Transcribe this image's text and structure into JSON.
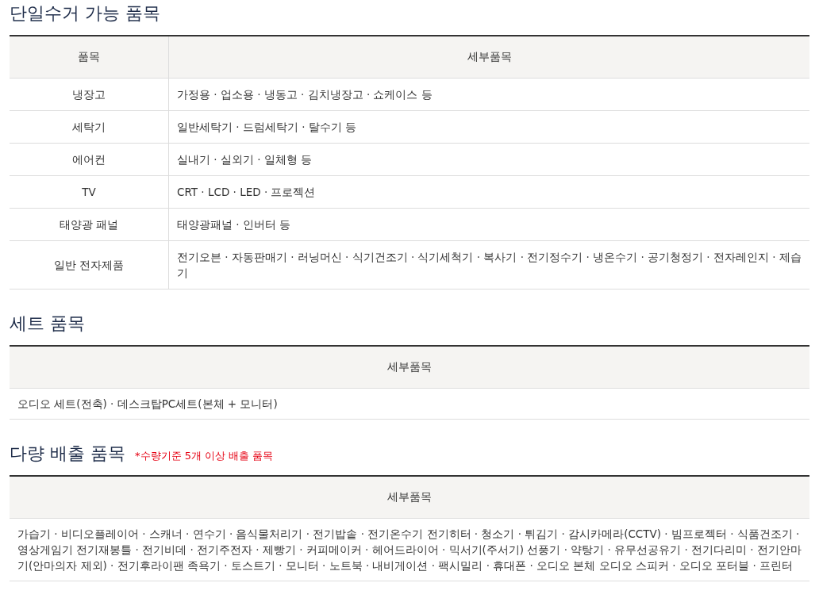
{
  "sections": [
    {
      "title": "단일수거 가능 품목",
      "columns": [
        "품목",
        "세부품목"
      ],
      "rows": [
        [
          "냉장고",
          "가정용 · 업소용 · 냉동고 · 김치냉장고 · 쇼케이스 등"
        ],
        [
          "세탁기",
          "일반세탁기 · 드럼세탁기 · 탈수기 등"
        ],
        [
          "에어컨",
          "실내기 · 실외기 · 일체형 등"
        ],
        [
          "TV",
          "CRT · LCD · LED · 프로젝션"
        ],
        [
          "태양광 패널",
          "태양광패널 · 인버터 등"
        ],
        [
          "일반 전자제품",
          "전기오븐 ·  자동판매기 ·  러닝머신 ·  식기건조기 ·  식기세척기 ·  복사기 ·  전기정수기 ·  냉온수기 ·  공기청정기 ·  전자레인지 ·  제습기"
        ]
      ]
    },
    {
      "title": "세트 품목",
      "columns": [
        "세부품목"
      ],
      "rows": [
        [
          "오디오 세트(전축) ·  데스크탑PC세트(본체 + 모니터)"
        ]
      ]
    },
    {
      "title": "다량 배출 품목",
      "note": "*수량기준 5개 이상 배출 품목",
      "columns": [
        "세부품목"
      ],
      "rows": [
        [
          "가습기 ·  비디오플레이어 ·  스캐너 ·  연수기 ·  음식물처리기 ·  전기밥솥 ·  전기온수기 전기히터 ·  청소기 ·  튀김기 ·  감시카메라(CCTV) ·  빔프로젝터 ·  식품건조기 ·  영상게임기 전기재봉틀 ·  전기비데 ·  전기주전자 ·  제빵기 ·  커피메이커 ·  헤어드라이어 ·  믹서기(주서기) 선풍기 ·  약탕기 ·  유무선공유기 ·  전기다리미 ·  전기안마기(안마의자 제외) ·  전기후라이팬 족욕기 ·  토스트기 ·  모니터 ·  노트북 ·  내비게이션 ·  팩시밀리 ·  휴대폰 ·  오디오 본체 오디오 스피커 ·  오디오 포터블 ·  프린터"
        ]
      ]
    }
  ]
}
